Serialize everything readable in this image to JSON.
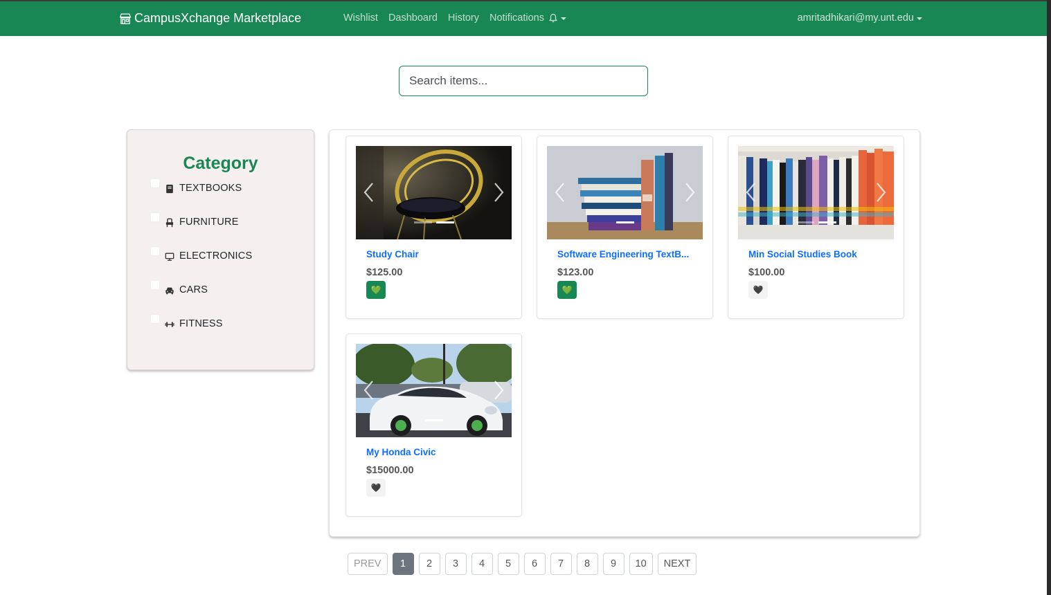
{
  "navbar": {
    "brand": "CampusXchange Marketplace",
    "links": [
      "Wishlist",
      "Dashboard",
      "History",
      "Notifications"
    ],
    "user": "amritadhikari@my.unt.edu",
    "color": "#198754"
  },
  "search": {
    "placeholder": "Search items..."
  },
  "sidebar": {
    "title": "Category",
    "categories": [
      {
        "label": "TEXTBOOKS",
        "icon": "book-icon"
      },
      {
        "label": "FURNITURE",
        "icon": "chair-icon"
      },
      {
        "label": "ELECTRONICS",
        "icon": "monitor-icon"
      },
      {
        "label": "CARS",
        "icon": "car-icon"
      },
      {
        "label": "FITNESS",
        "icon": "dumbbell-icon"
      }
    ]
  },
  "products": [
    {
      "title": "Study Chair",
      "price": "$125.00",
      "wishlisted": true,
      "heart": "💚"
    },
    {
      "title": "Software Engineering TextB...",
      "price": "$123.00",
      "wishlisted": true,
      "heart": "💚"
    },
    {
      "title": "Min Social Studies Book",
      "price": "$100.00",
      "wishlisted": false,
      "heart": "🖤"
    },
    {
      "title": "My Honda Civic",
      "price": "$15000.00",
      "wishlisted": false,
      "heart": "🖤"
    }
  ],
  "pagination": {
    "prev": "PREV",
    "pages": [
      "1",
      "2",
      "3",
      "4",
      "5",
      "6",
      "7",
      "8",
      "9",
      "10"
    ],
    "current": "1",
    "next": "NEXT"
  }
}
